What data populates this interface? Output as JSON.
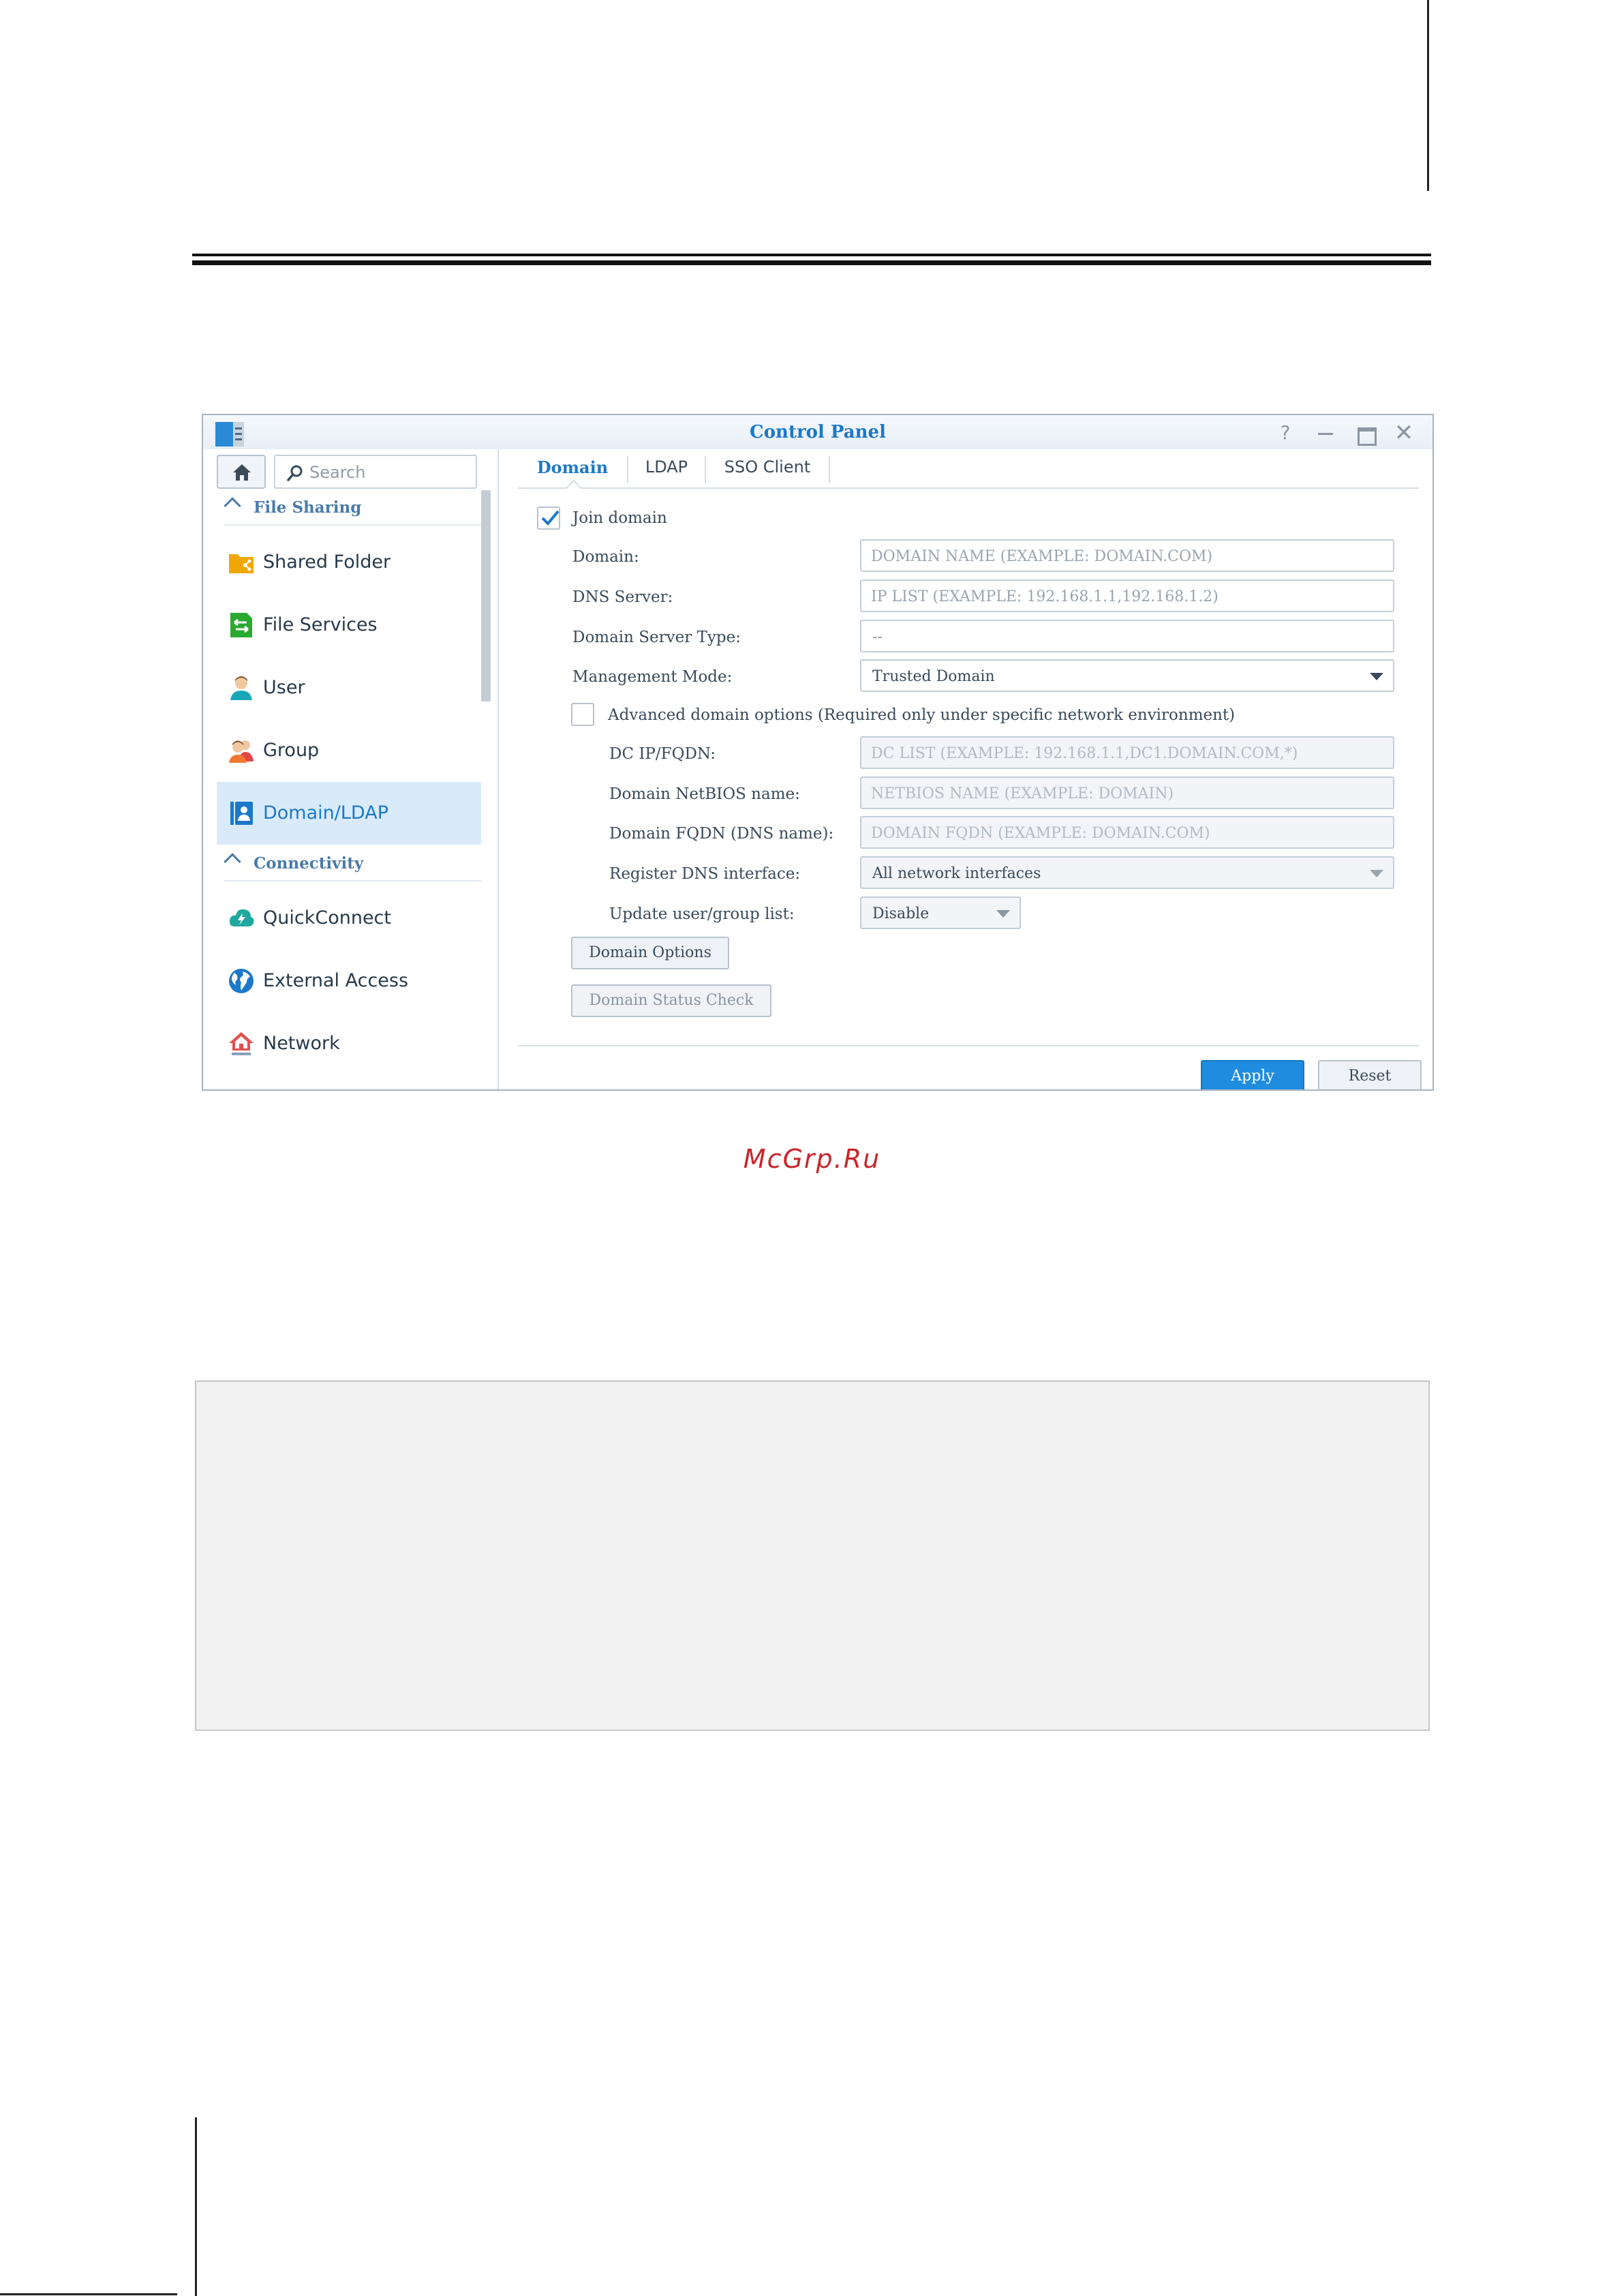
{
  "window": {
    "title": "Control Panel",
    "help_glyph": "?",
    "close_glyph": "✕"
  },
  "sidebar": {
    "search_placeholder": "Search",
    "sections": [
      {
        "label": "File Sharing",
        "items": [
          {
            "label": "Shared Folder",
            "icon": "shared-folder-icon"
          },
          {
            "label": "File Services",
            "icon": "file-services-icon"
          },
          {
            "label": "User",
            "icon": "user-icon"
          },
          {
            "label": "Group",
            "icon": "group-icon"
          },
          {
            "label": "Domain/LDAP",
            "icon": "domain-ldap-icon",
            "active": true
          }
        ]
      },
      {
        "label": "Connectivity",
        "items": [
          {
            "label": "QuickConnect",
            "icon": "quickconnect-icon"
          },
          {
            "label": "External Access",
            "icon": "external-access-icon"
          },
          {
            "label": "Network",
            "icon": "network-icon"
          }
        ]
      }
    ]
  },
  "tabs": [
    {
      "label": "Domain",
      "active": true
    },
    {
      "label": "LDAP"
    },
    {
      "label": "SSO Client"
    }
  ],
  "form": {
    "join_domain": {
      "label": "Join domain",
      "checked": true
    },
    "domain": {
      "label": "Domain:",
      "placeholder": "DOMAIN NAME (EXAMPLE: DOMAIN.COM)"
    },
    "dns_server": {
      "label": "DNS Server:",
      "placeholder": "IP LIST (EXAMPLE: 192.168.1.1,192.168.1.2)"
    },
    "domain_server_type": {
      "label": "Domain Server Type:",
      "value": "--"
    },
    "management_mode": {
      "label": "Management Mode:",
      "value": "Trusted Domain"
    },
    "advanced": {
      "label": "Advanced domain options (Required only under specific network environment)",
      "checked": false
    },
    "dc_ip": {
      "label": "DC IP/FQDN:",
      "placeholder": "DC LIST (EXAMPLE: 192.168.1.1,DC1.DOMAIN.COM,*)"
    },
    "netbios": {
      "label": "Domain NetBIOS name:",
      "placeholder": "NETBIOS NAME (EXAMPLE: DOMAIN)"
    },
    "fqdn": {
      "label": "Domain FQDN (DNS name):",
      "placeholder": "DOMAIN FQDN (EXAMPLE: DOMAIN.COM)"
    },
    "register_dns": {
      "label": "Register DNS interface:",
      "value": "All network interfaces"
    },
    "update_list": {
      "label": "Update user/group list:",
      "value": "Disable"
    },
    "domain_options_button": "Domain Options",
    "domain_status_button": "Domain Status Check"
  },
  "footer": {
    "apply": "Apply",
    "reset": "Reset"
  },
  "watermark": "McGrp.Ru",
  "colors": {
    "accent": "#1c78c8",
    "primary_button": "#1f8ce0",
    "active_nav": "#d9ebfa",
    "watermark": "#c8262b"
  }
}
